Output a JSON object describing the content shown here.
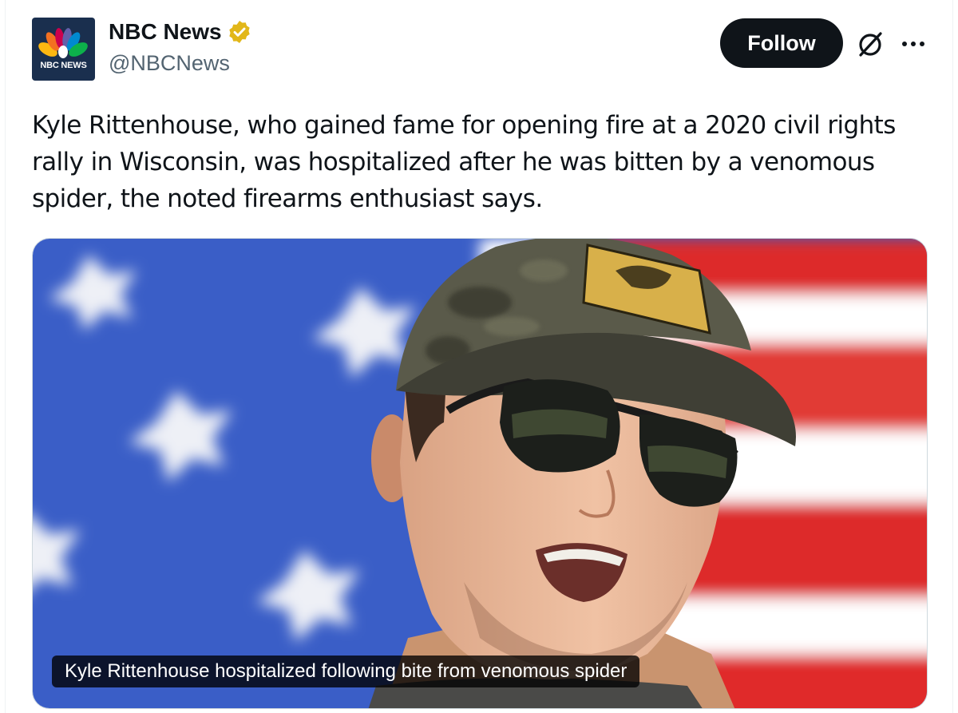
{
  "account": {
    "display_name": "NBC News",
    "handle": "@NBCNews",
    "avatar_text": "NBC NEWS",
    "verified_badge": "gold-verified-badge"
  },
  "actions": {
    "follow_label": "Follow",
    "grok_icon": "grok-icon",
    "more_icon": "more-icon"
  },
  "tweet": {
    "text": "Kyle Rittenhouse, who gained fame for opening fire at a 2020 civil rights rally in Wisconsin, was hospitalized after he was bitten by a venomous spider, the noted firearms enthusiast says."
  },
  "media": {
    "caption": "Kyle Rittenhouse hospitalized following bite from venomous spider"
  },
  "colors": {
    "text_primary": "#0f1419",
    "text_secondary": "#536471",
    "verified_gold": "#e2b719",
    "flag_blue": "#3a5ec7",
    "flag_red": "#dd2a2a"
  }
}
